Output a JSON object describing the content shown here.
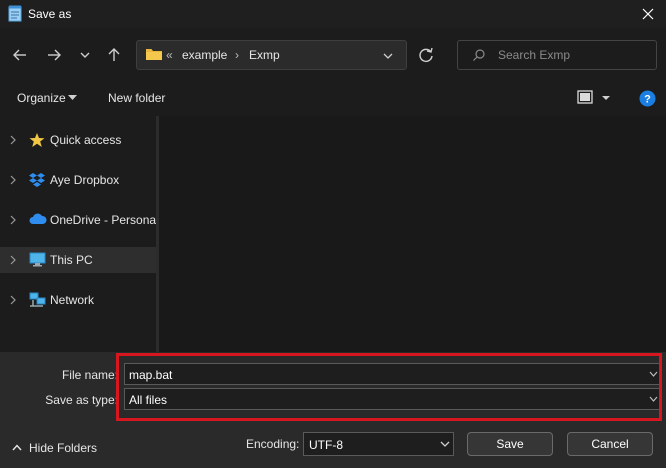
{
  "window": {
    "title": "Save as"
  },
  "nav": {
    "address": {
      "parent_crumb": "example",
      "current_crumb": "Exmp"
    },
    "search_placeholder": "Search Exmp"
  },
  "toolbar": {
    "organize_label": "Organize",
    "new_folder_label": "New folder"
  },
  "sidebar": {
    "items": [
      {
        "label": "Quick access",
        "icon": "star-icon"
      },
      {
        "label": "Aye Dropbox",
        "icon": "dropbox-icon"
      },
      {
        "label": "OneDrive - Personal",
        "icon": "cloud-icon"
      },
      {
        "label": "This PC",
        "icon": "monitor-icon",
        "selected": true
      },
      {
        "label": "Network",
        "icon": "network-icon"
      }
    ]
  },
  "form": {
    "file_name_label": "File name:",
    "file_name_value": "map.bat",
    "save_as_type_label": "Save as type:",
    "save_as_type_value": "All files",
    "encoding_label": "Encoding:",
    "encoding_value": "UTF-8"
  },
  "footer": {
    "hide_folders_label": "Hide Folders",
    "save_label": "Save",
    "cancel_label": "Cancel"
  },
  "colors": {
    "highlight": "#d8161f",
    "help": "#1a7fe0",
    "folder": "#e8b73d"
  }
}
